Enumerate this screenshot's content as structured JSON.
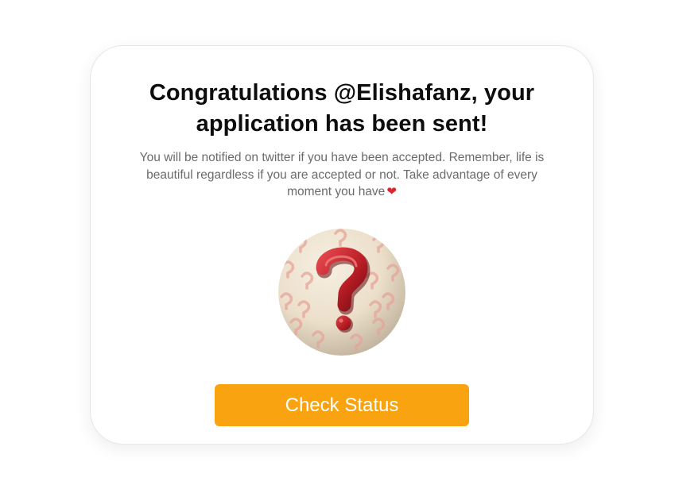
{
  "dialog": {
    "title": "Congratulations @Elishafanz, your application has been sent!",
    "message": "You will be notified on twitter if you have been accepted. Remember, life is beautiful regardless if you are accepted or not. Take advantage of every moment you have",
    "message_emoji": "heart-emoji",
    "image_icon": "question-mark-icon",
    "button_label": "Check Status"
  },
  "colors": {
    "button": "#f9a311",
    "title": "#0d0d0d",
    "message": "#6b6b6b",
    "heart": "#e0242f",
    "question_mark": "#b81c24",
    "avatar_background": "#efe4d2"
  }
}
